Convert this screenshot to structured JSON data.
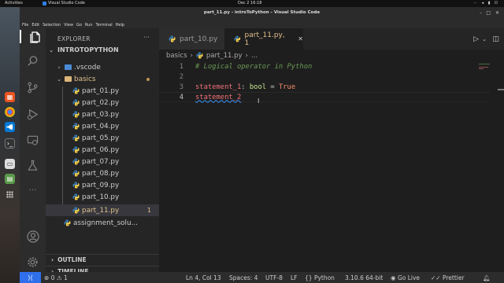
{
  "gnome": {
    "activities": "Activities",
    "app_name": "Visual Studio Code",
    "clock": "Dec 2  16:18"
  },
  "window": {
    "title": "part_11.py - introToPython - Visual Studio Code",
    "menu": [
      "File",
      "Edit",
      "Selection",
      "View",
      "Go",
      "Run",
      "Terminal",
      "Help"
    ]
  },
  "explorer": {
    "header": "EXPLORER",
    "root": "INTROTOPYTHON",
    "items": [
      {
        "label": ".vscode",
        "kind": "folder"
      },
      {
        "label": "basics",
        "kind": "folder-open"
      },
      {
        "label": "part_01.py"
      },
      {
        "label": "part_02.py"
      },
      {
        "label": "part_03.py"
      },
      {
        "label": "part_04.py"
      },
      {
        "label": "part_05.py"
      },
      {
        "label": "part_06.py"
      },
      {
        "label": "part_07.py"
      },
      {
        "label": "part_08.py"
      },
      {
        "label": "part_09.py"
      },
      {
        "label": "part_10.py"
      },
      {
        "label": "part_11.py",
        "badge": "1"
      },
      {
        "label": "assignment_solu..."
      }
    ],
    "outline": "OUTLINE",
    "timeline": "TIMELINE"
  },
  "tabs": [
    {
      "label": "part_10.py"
    },
    {
      "label": "part_11.py",
      "badge": "1"
    }
  ],
  "breadcrumb": {
    "folder": "basics",
    "file": "part_11.py",
    "more": "..."
  },
  "editor": {
    "line_numbers": [
      "1",
      "2",
      "3",
      "4"
    ],
    "line1_comment": "# Logical operator in Python",
    "line3_name": "statement_1",
    "line3_colon": ":",
    "line3_type": "bool",
    "line3_eq": "=",
    "line3_value": "True",
    "line4_text": "statement_2"
  },
  "status": {
    "errors": "0",
    "warnings": "1",
    "position": "Ln 4, Col 13",
    "spaces": "Spaces: 4",
    "encoding": "UTF-8",
    "eol": "LF",
    "language": "Python",
    "interpreter": "3.10.6 64-bit",
    "golive": "Go Live",
    "prettier": "Prettier"
  },
  "colors": {
    "accent": "#2f6feb",
    "comment": "#6a9955",
    "variable": "#f07178",
    "type": "#c3e88d",
    "boolean": "#f78c6c",
    "modified": "#e2c08d"
  }
}
